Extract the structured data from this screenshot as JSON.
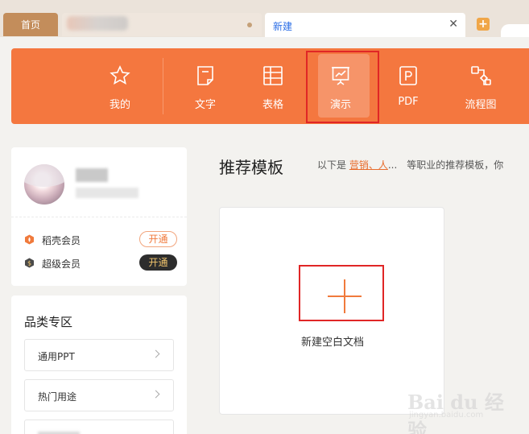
{
  "tabs": {
    "home": "首页",
    "new": "新建",
    "close_glyph": "✕",
    "add_glyph": "+"
  },
  "nav": [
    {
      "label": "我的",
      "icon": "star-icon"
    },
    {
      "label": "文字",
      "icon": "writer-doc-icon"
    },
    {
      "label": "表格",
      "icon": "spreadsheet-icon"
    },
    {
      "label": "演示",
      "icon": "presentation-icon",
      "active": true
    },
    {
      "label": "PDF",
      "icon": "pdf-icon"
    },
    {
      "label": "流程图",
      "icon": "flowchart-icon"
    }
  ],
  "profile": {
    "vip1": {
      "label": "稻壳会员",
      "button": "开通"
    },
    "vip2": {
      "label": "超级会员",
      "button": "开通"
    }
  },
  "category": {
    "title": "品类专区",
    "items": [
      "通用PPT",
      "热门用途"
    ]
  },
  "main": {
    "title": "推荐模板",
    "desc_prefix": "以下是",
    "desc_highlight": "营销、人",
    "desc_suffix": "...　等职业的推荐模板，你",
    "new_blank": "新建空白文档"
  },
  "watermark": {
    "main": "Bai du 经验",
    "sub": "jingyan.baidu.com"
  },
  "colors": {
    "banner": "#f4773f",
    "accent": "#f07a3c",
    "highlight_box": "#e02626"
  }
}
